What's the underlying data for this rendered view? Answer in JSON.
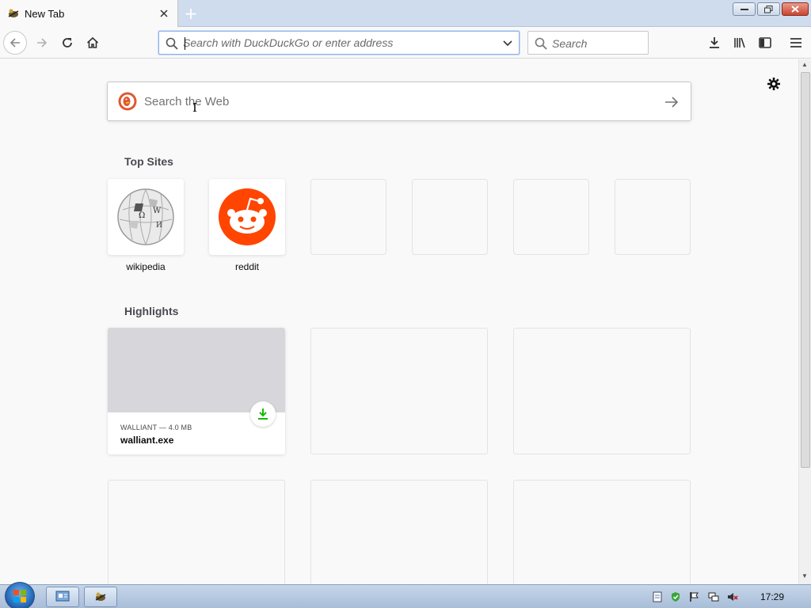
{
  "window": {
    "tab_title": "New Tab",
    "new_tab_symbol": "+"
  },
  "toolbar": {
    "url_placeholder": "Search with DuckDuckGo or enter address",
    "search_placeholder": "Search"
  },
  "newtab": {
    "web_search_placeholder": "Search the Web",
    "top_sites_title": "Top Sites",
    "highlights_title": "Highlights",
    "top_sites": [
      {
        "label": "wikipedia",
        "icon": "wikipedia-globe-icon"
      },
      {
        "label": "reddit",
        "icon": "reddit-alien-icon"
      },
      {
        "label": ""
      },
      {
        "label": ""
      },
      {
        "label": ""
      },
      {
        "label": ""
      }
    ],
    "highlights": [
      {
        "context": "WALLIANT — 4.0 MB",
        "title": "walliant.exe",
        "icon": "download-icon"
      }
    ]
  },
  "taskbar": {
    "clock": "17:29"
  },
  "colors": {
    "reddit_orange": "#ff4500",
    "download_green": "#12bc00",
    "url_focus_border": "#8fb3e6"
  }
}
